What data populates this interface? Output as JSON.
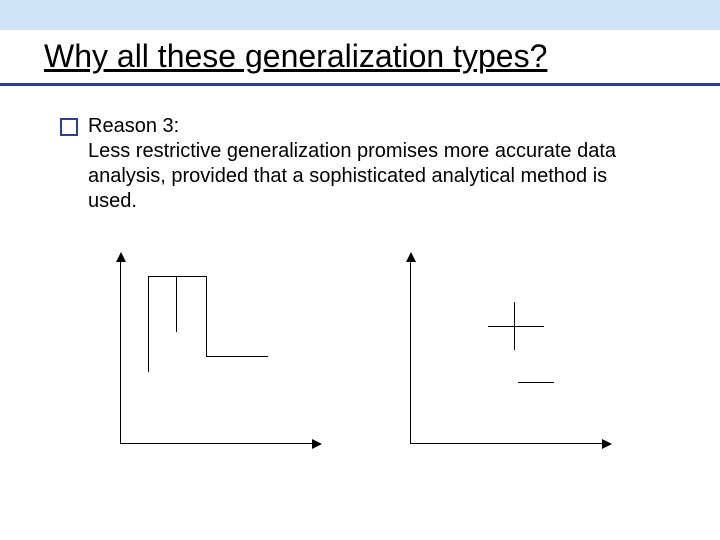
{
  "slide": {
    "title": "Why all these generalization types?",
    "bullet": {
      "lead": "Reason 3:",
      "body": "Less restrictive generalization promises more accurate data analysis, provided that a sophisticated analytical method is used."
    }
  }
}
